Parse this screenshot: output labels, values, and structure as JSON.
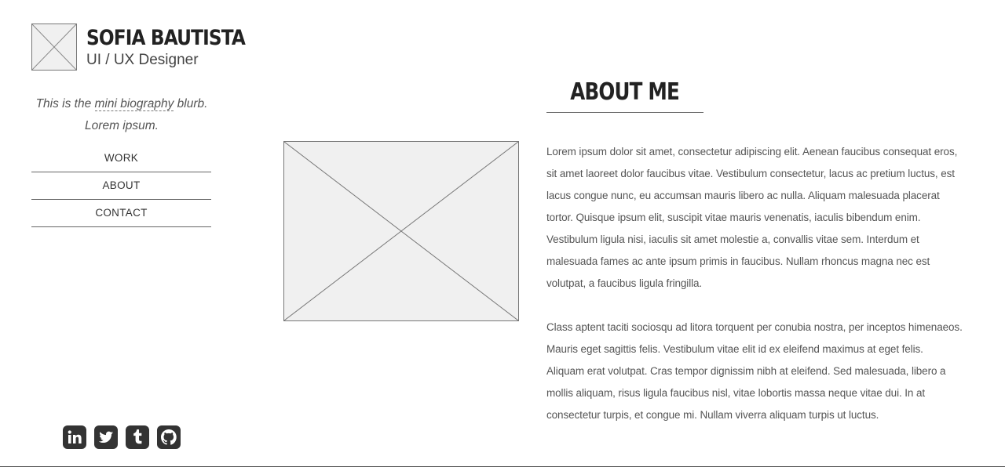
{
  "profile": {
    "name": "SOFIA BAUTISTA",
    "role": "UI / UX Designer",
    "bio_prefix": "This is the ",
    "bio_link": "mini biography",
    "bio_suffix": " blurb. Lorem ipsum."
  },
  "nav": {
    "items": [
      {
        "label": "WORK"
      },
      {
        "label": "ABOUT"
      },
      {
        "label": "CONTACT"
      }
    ]
  },
  "social": {
    "icons": [
      "linkedin-icon",
      "twitter-icon",
      "tumblr-icon",
      "github-icon"
    ],
    "icon_color": "#333333"
  },
  "about": {
    "title": "ABOUT ME",
    "paragraphs": [
      "Lorem ipsum dolor sit amet, consectetur adipiscing elit. Aenean faucibus consequat eros, sit amet laoreet dolor faucibus vitae. Vestibulum consectetur, lacus ac pretium luctus, est lacus congue nunc, eu accumsan mauris libero ac nulla. Aliquam malesuada placerat tortor. Quisque ipsum elit, suscipit vitae mauris venenatis, iaculis bibendum enim. Vestibulum ligula nisi, iaculis sit amet molestie a, convallis vitae sem. Interdum et malesuada fames ac ante ipsum primis in faucibus. Nullam rhoncus magna nec est volutpat, a faucibus ligula fringilla.",
      "Class aptent taciti sociosqu ad litora torquent per conubia nostra, per inceptos himenaeos. Mauris eget sagittis felis. Vestibulum vitae elit id ex eleifend maximus at eget felis. Aliquam erat volutpat. Cras tempor dignissim nibh at eleifend. Sed malesuada, libero a mollis aliquam, risus ligula faucibus nisl, vitae lobortis massa neque vitae dui. In at consectetur turpis, et congue mi. Nullam viverra aliquam turpis ut luctus."
    ]
  },
  "colors": {
    "text": "#333333",
    "placeholder_fill": "#f0f0f0",
    "rule": "#666666"
  }
}
